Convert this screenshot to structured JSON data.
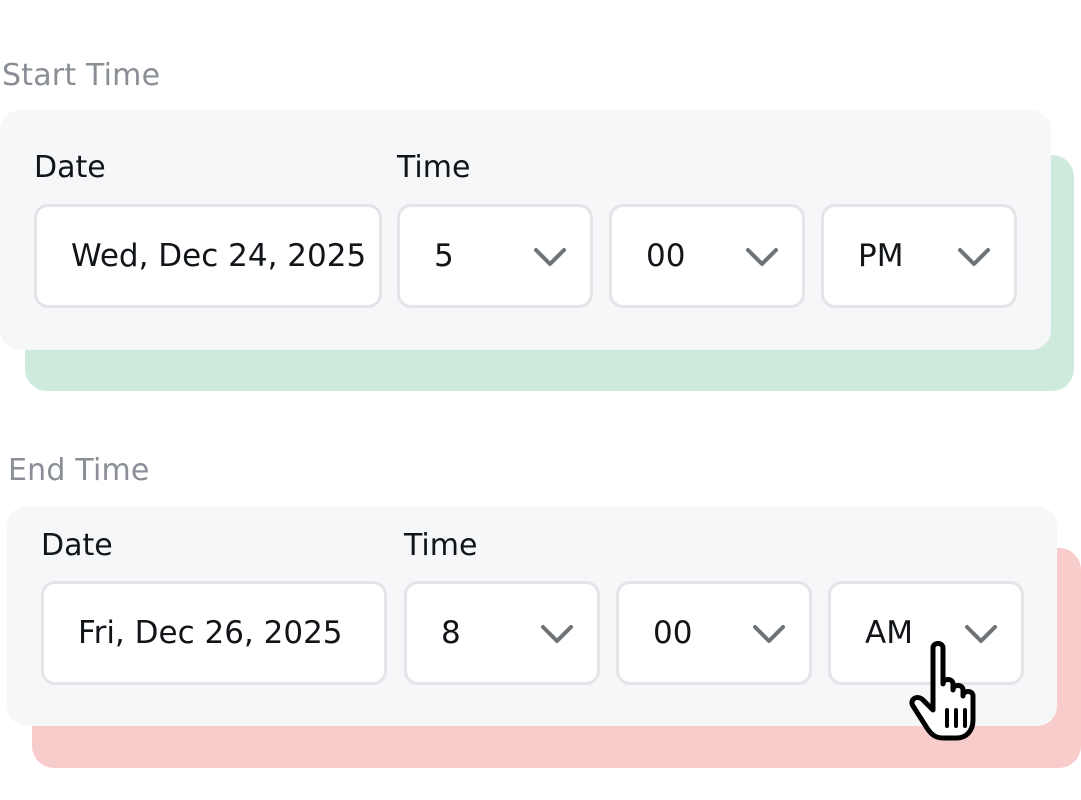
{
  "start": {
    "section_title": "Start Time",
    "date_label": "Date",
    "time_label": "Time",
    "date_value": "Wed, Dec 24, 2025",
    "hour": "5",
    "minute": "00",
    "period": "PM",
    "accent_color": "#cdeadd"
  },
  "end": {
    "section_title": "End Time",
    "date_label": "Date",
    "time_label": "Time",
    "date_value": "Fri, Dec 26, 2025",
    "hour": "8",
    "minute": "00",
    "period": "AM",
    "accent_color": "#f8cccb"
  },
  "icons": {
    "dropdown": "chevron-down-icon",
    "pointer": "hand-pointer-cursor-icon"
  }
}
